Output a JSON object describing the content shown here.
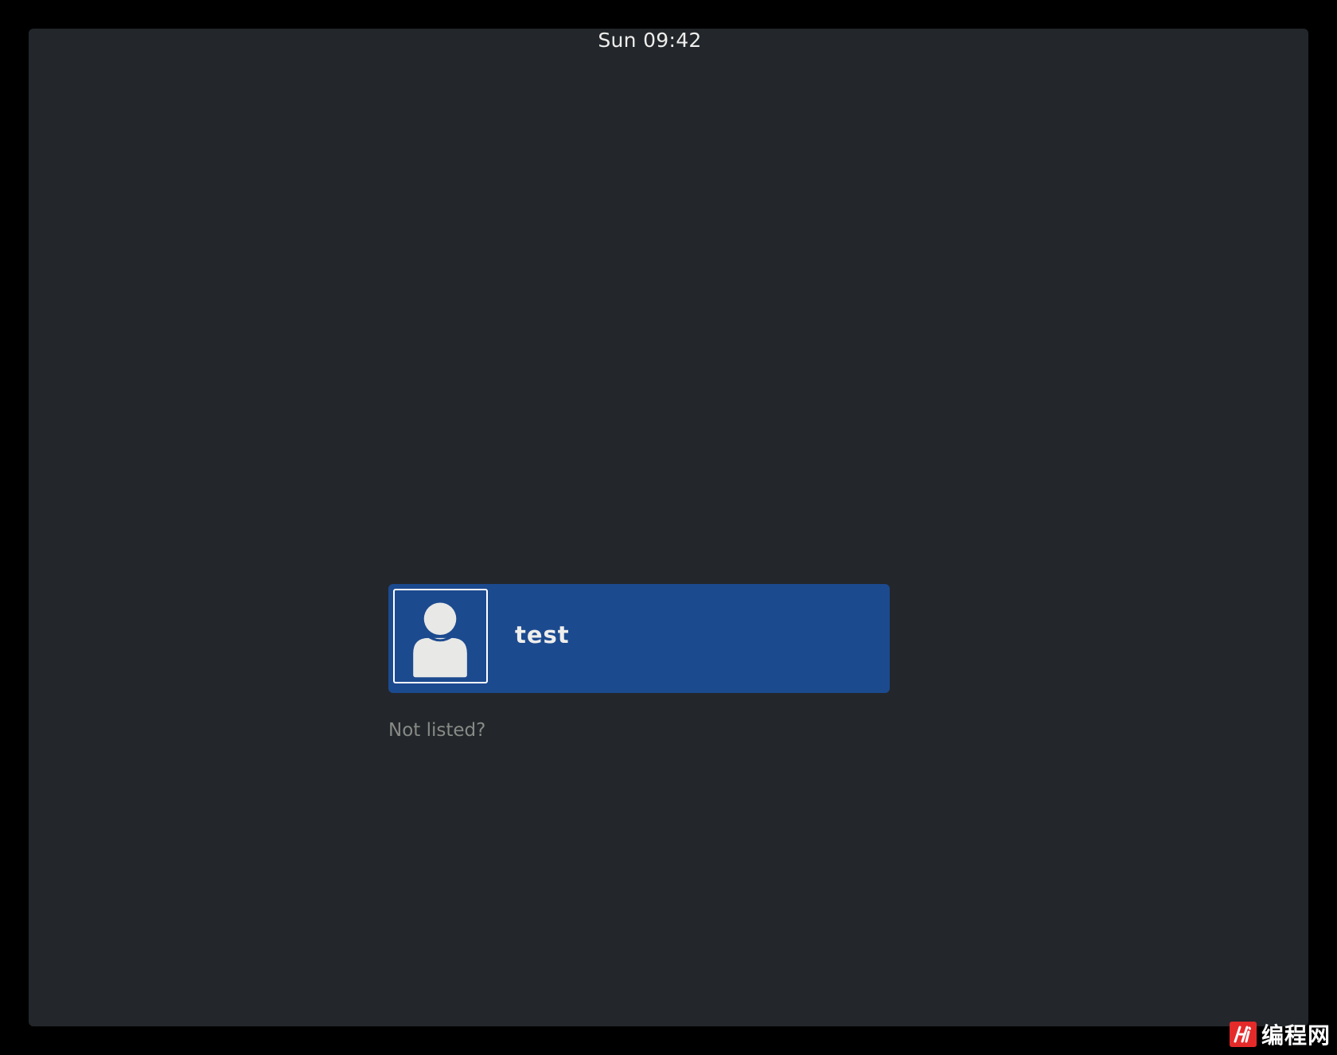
{
  "topbar": {
    "clock": "Sun 09:42"
  },
  "login": {
    "users": [
      {
        "name": "test",
        "avatar_icon": "user-icon"
      }
    ],
    "not_listed_label": "Not listed?"
  },
  "watermark": {
    "text": "编程网"
  },
  "colors": {
    "background": "#23272b",
    "selected_row": "#1c4a8f",
    "avatar_glyph": "#e8e8e6",
    "muted_text": "#888a85",
    "watermark_badge": "#e52a2a"
  }
}
